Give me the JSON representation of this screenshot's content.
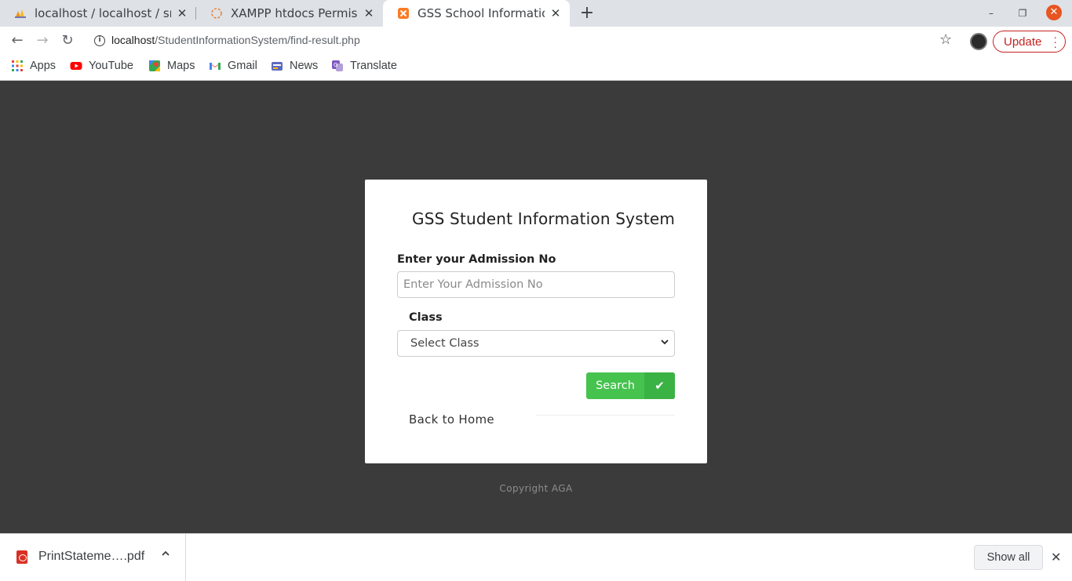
{
  "browser": {
    "tabs": [
      {
        "title": "localhost / localhost / srm",
        "icon": "phpmyadmin-icon",
        "close": "✕"
      },
      {
        "title": "XAMPP htdocs Permissio",
        "icon": "xampp-loading-icon",
        "close": "✕"
      },
      {
        "title": "GSS School Information S",
        "icon": "xampp-icon",
        "close": "✕"
      }
    ],
    "new_tab": "+",
    "window_controls": {
      "minimize": "–",
      "restore": "❐",
      "close": "✕"
    },
    "nav": {
      "back": "←",
      "forward": "→",
      "reload": "↻"
    },
    "address": {
      "host": "localhost",
      "path": "/StudentInformationSystem/find-result.php"
    },
    "star": "☆",
    "update_label": "Update",
    "menu_dots": "⋮"
  },
  "bookmarks": [
    {
      "label": "Apps",
      "icon": "apps-grid-icon"
    },
    {
      "label": "YouTube",
      "icon": "youtube-icon"
    },
    {
      "label": "Maps",
      "icon": "maps-icon"
    },
    {
      "label": "Gmail",
      "icon": "gmail-icon"
    },
    {
      "label": "News",
      "icon": "news-icon"
    },
    {
      "label": "Translate",
      "icon": "translate-icon"
    }
  ],
  "page": {
    "title": "GSS Student Information System",
    "admission_label": "Enter your Admission No",
    "admission_placeholder": "Enter Your Admission No",
    "admission_value": "",
    "class_label": "Class",
    "class_selected": "Select Class",
    "search_label": "Search",
    "search_icon": "✔",
    "back_link": "Back to Home",
    "copyright": "Copyright AGA"
  },
  "downloads": {
    "file_name": "PrintStateme….pdf",
    "chevron": "⌃",
    "show_all": "Show all",
    "close": "✕"
  },
  "colors": {
    "page_bg": "#3b3b3b",
    "search_green": "#45c34e",
    "update_red": "#c5221f"
  }
}
